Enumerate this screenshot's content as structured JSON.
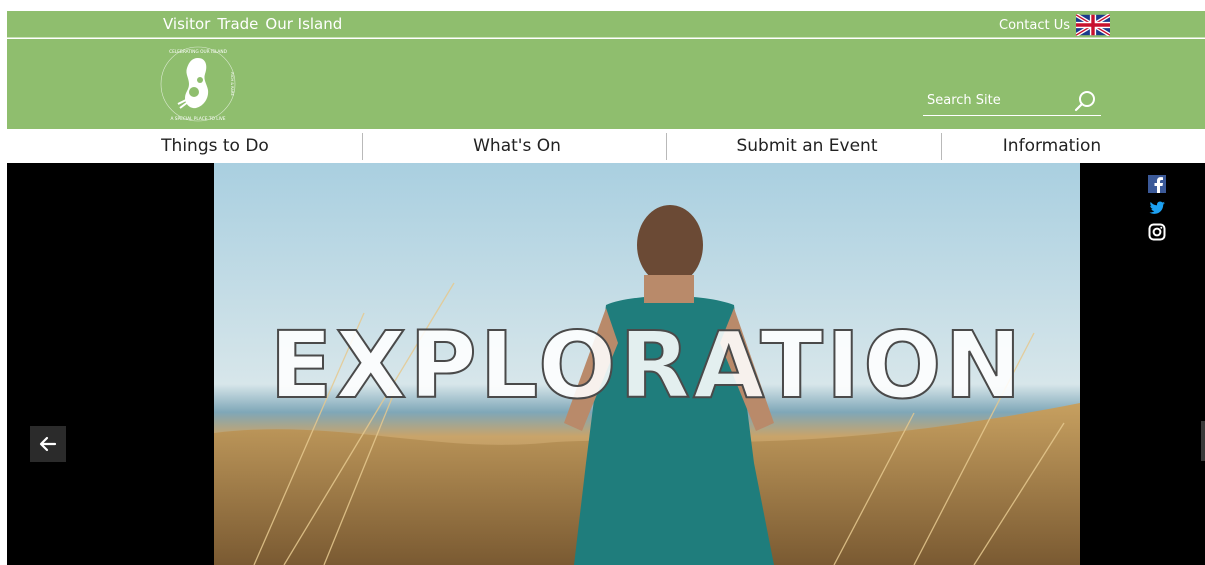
{
  "topbar": {
    "links": [
      "Visitor",
      "Trade",
      "Our Island"
    ],
    "contact_label": "Contact Us",
    "language_icon": "uk-flag-icon"
  },
  "logo": {
    "ring_text_top": "CELEBRATING OUR ISLAND",
    "ring_text_right": "RICH & RARE",
    "ring_text_bottom": "A SPECIAL PLACE TO LIVE",
    "icon": "isle-of-man-logo-icon"
  },
  "search": {
    "placeholder": "Search Site",
    "icon": "search-icon"
  },
  "nav": {
    "items": [
      "Things to Do",
      "What's On",
      "Submit an Event",
      "Information"
    ]
  },
  "hero": {
    "title": "EXPLORATION",
    "prev_icon": "arrow-left-icon"
  },
  "social": [
    "facebook-icon",
    "twitter-icon",
    "instagram-icon"
  ],
  "colors": {
    "brand_green": "#8fbe6e",
    "nav_text": "#222222",
    "hero_bg": "#000000"
  }
}
